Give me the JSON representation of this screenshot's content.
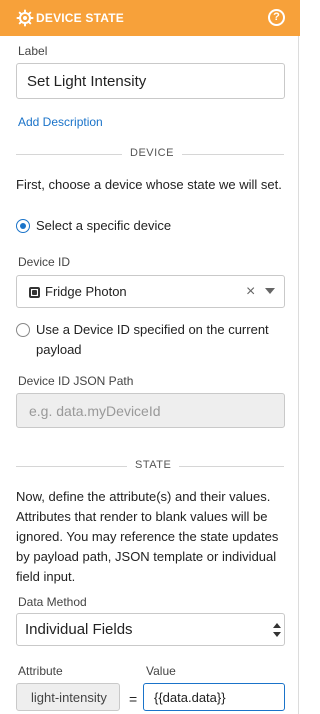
{
  "header": {
    "title": "DEVICE STATE",
    "help_icon": "?"
  },
  "label_field": {
    "label": "Label",
    "value": "Set Light Intensity"
  },
  "add_description": "Add Description",
  "device_section": {
    "title": "DEVICE",
    "intro": "First, choose a device whose state we will set.",
    "option_specific": "Select a specific device",
    "device_id_label": "Device ID",
    "device_id_value": "Fridge Photon",
    "clear_icon": "×",
    "option_payload": "Use a Device ID specified on the current payload",
    "json_path_label": "Device ID JSON Path",
    "json_path_placeholder": "e.g. data.myDeviceId"
  },
  "state_section": {
    "title": "STATE",
    "intro": "Now, define the attribute(s) and their values. Attributes that render to blank values will be ignored. You may reference the state updates by payload path, JSON template or individual field input.",
    "data_method_label": "Data Method",
    "data_method_value": "Individual Fields",
    "attribute_header": "Attribute",
    "value_header": "Value",
    "rows": [
      {
        "attribute": "light-intensity",
        "equals": "=",
        "value": "{{data.data}}"
      }
    ]
  },
  "colors": {
    "header_bg": "#f7a13a",
    "accent": "#1a73c9"
  }
}
